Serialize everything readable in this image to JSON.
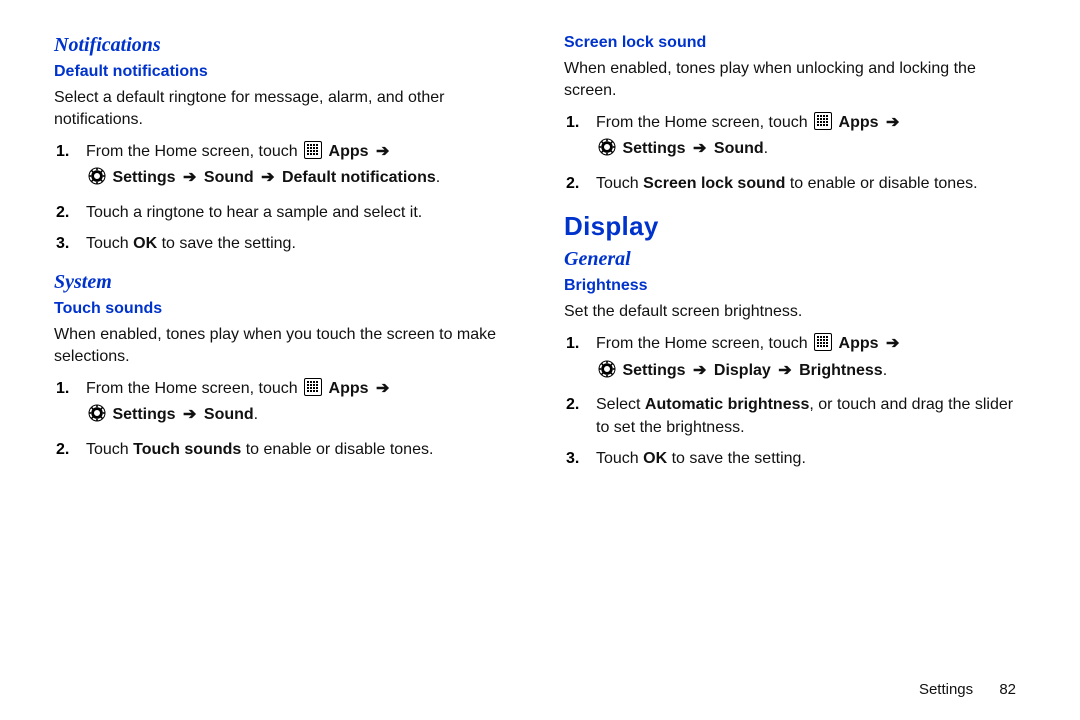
{
  "arrow": "➔",
  "left": {
    "notifications": {
      "heading": "Notifications",
      "default": {
        "title": "Default notifications",
        "intro": "Select a default ringtone for message, alarm, and other notifications.",
        "step1_pre": "From the Home screen, touch ",
        "apps": "Apps",
        "step1_line2a": "Settings",
        "step1_line2b": "Sound",
        "step1_line2c": "Default notifications",
        "step2": "Touch a ringtone to hear a sample and select it.",
        "step3_a": "Touch ",
        "step3_b": "OK",
        "step3_c": " to save the setting."
      }
    },
    "system": {
      "heading": "System",
      "touch_sounds": {
        "title": "Touch sounds",
        "intro": "When enabled, tones play when you touch the screen to make selections.",
        "step1_pre": "From the Home screen, touch ",
        "apps": "Apps",
        "step1_line2a": "Settings",
        "step1_line2b": "Sound",
        "step2_a": "Touch ",
        "step2_b": "Touch sounds",
        "step2_c": " to enable or disable tones."
      }
    }
  },
  "right": {
    "screen_lock": {
      "title": "Screen lock sound",
      "intro": "When enabled, tones play when unlocking and locking the screen.",
      "step1_pre": "From the Home screen, touch ",
      "apps": "Apps",
      "step1_line2a": "Settings",
      "step1_line2b": "Sound",
      "step2_a": "Touch ",
      "step2_b": "Screen lock sound",
      "step2_c": " to enable or disable tones."
    },
    "display": {
      "heading": "Display",
      "general": {
        "heading": "General",
        "brightness": {
          "title": "Brightness",
          "intro": "Set the default screen brightness.",
          "step1_pre": "From the Home screen, touch ",
          "apps": "Apps",
          "step1_line2a": "Settings",
          "step1_line2b": "Display",
          "step1_line2c": "Brightness",
          "step2_a": "Select ",
          "step2_b": "Automatic brightness",
          "step2_c": ", or touch and drag the slider to set the brightness.",
          "step3_a": "Touch ",
          "step3_b": "OK",
          "step3_c": " to save the setting."
        }
      }
    }
  },
  "footer": {
    "section": "Settings",
    "page": "82"
  }
}
